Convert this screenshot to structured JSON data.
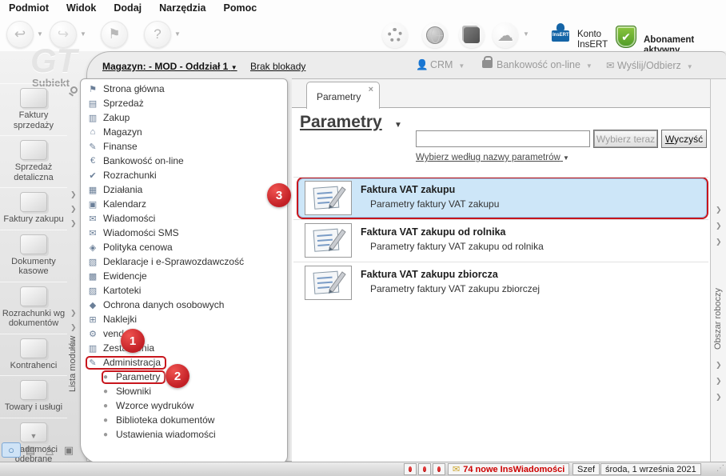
{
  "colors": {
    "accent_red": "#c8161d",
    "selection_blue": "#cde6f8",
    "status_red": "#cc0000",
    "insert_blue": "#1565a7",
    "abonament_green": "#4e9a26"
  },
  "menubar": {
    "items": [
      {
        "label": "Podmiot"
      },
      {
        "label": "Widok"
      },
      {
        "label": "Dodaj"
      },
      {
        "label": "Narzędzia"
      },
      {
        "label": "Pomoc"
      }
    ]
  },
  "toolbar_right": {
    "konto_line1": "Konto",
    "konto_line2": "InsERT",
    "stamp_text": "InsERT",
    "abonament_label": "Abonament aktywny",
    "shield_check": "✔"
  },
  "subheader": {
    "magazyn_label": "Magazyn: - MOD - Oddział 1",
    "caret": "▼",
    "brak_blokady": "Brak blokady",
    "crm_label": "CRM",
    "bank_label": "Bankowość on-line",
    "send_label": "Wyślij/Odbierz"
  },
  "logo": {
    "gt": "GT",
    "name": "Subiekt"
  },
  "module_strip": {
    "label": "Lista modułów"
  },
  "modules": {
    "items": [
      {
        "label": "Faktury sprzedaży"
      },
      {
        "label": "Sprzedaż detaliczna"
      },
      {
        "label": "Faktury zakupu"
      },
      {
        "label": "Dokumenty kasowe"
      },
      {
        "label": "Rozrachunki wg dokumentów"
      },
      {
        "label": "Kontrahenci"
      },
      {
        "label": "Towary i usługi"
      },
      {
        "label": "Wiadomości odebrane"
      }
    ]
  },
  "tree": {
    "items": [
      {
        "label": "Strona główna",
        "icon": "⚑"
      },
      {
        "label": "Sprzedaż",
        "icon": "▤"
      },
      {
        "label": "Zakup",
        "icon": "▥"
      },
      {
        "label": "Magazyn",
        "icon": "⌂"
      },
      {
        "label": "Finanse",
        "icon": "✎"
      },
      {
        "label": "Bankowość on-line",
        "icon": "€"
      },
      {
        "label": "Rozrachunki",
        "icon": "✔"
      },
      {
        "label": "Działania",
        "icon": "▦"
      },
      {
        "label": "Kalendarz",
        "icon": "▣"
      },
      {
        "label": "Wiadomości",
        "icon": "✉"
      },
      {
        "label": "Wiadomości SMS",
        "icon": "✉"
      },
      {
        "label": "Polityka cenowa",
        "icon": "◈"
      },
      {
        "label": "Deklaracje i e-Sprawozdawczość",
        "icon": "▧"
      },
      {
        "label": "Ewidencje",
        "icon": "▩"
      },
      {
        "label": "Kartoteki",
        "icon": "▨"
      },
      {
        "label": "Ochrona danych osobowych",
        "icon": "◆"
      },
      {
        "label": "Naklejki",
        "icon": "⊞"
      },
      {
        "label": "vendero",
        "icon": "⚙"
      },
      {
        "label": "Zestawienia",
        "icon": "▥"
      },
      {
        "label": "Administracja",
        "icon": "✎",
        "boxed": true
      }
    ],
    "sub_items": [
      {
        "label": "Parametry",
        "boxed": true
      },
      {
        "label": "Słowniki"
      },
      {
        "label": "Wzorce wydruków"
      },
      {
        "label": "Biblioteka dokumentów"
      },
      {
        "label": "Ustawienia wiadomości"
      }
    ]
  },
  "main": {
    "tab_label": "Parametry",
    "tab_close": "×",
    "title": "Parametry",
    "search_value": "",
    "choose_button": "Wybierz teraz",
    "clear_button_accel": "W",
    "clear_button_rest": "yczyść",
    "filter_link": "Wybierz według nazwy parametrów",
    "items": [
      {
        "title": "Faktura VAT zakupu",
        "desc": "Parametry faktury VAT zakupu",
        "selected": true
      },
      {
        "title": "Faktura VAT zakupu od rolnika",
        "desc": "Parametry faktury VAT zakupu od rolnika"
      },
      {
        "title": "Faktura VAT zakupu zbiorcza",
        "desc": "Parametry faktury VAT zakupu zbiorczej"
      }
    ]
  },
  "right_strip": {
    "label": "Obszar roboczy"
  },
  "statusbar": {
    "messages": "74 nowe InsWiadomości",
    "user": "Szef",
    "date": "środa, 1 września 2021"
  },
  "annotations": {
    "circle1": "1",
    "circle2": "2",
    "circle3": "3"
  }
}
